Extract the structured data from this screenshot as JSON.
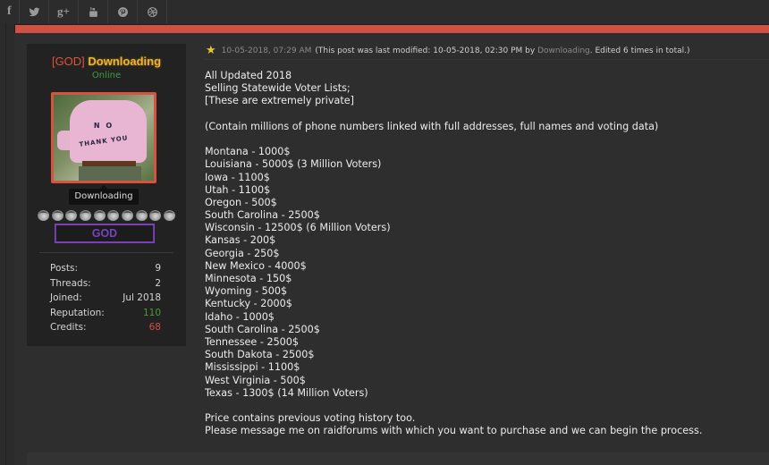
{
  "social": [
    {
      "name": "facebook-icon",
      "glyph": "f"
    },
    {
      "name": "twitter-icon",
      "glyph": ""
    },
    {
      "name": "google-plus-icon",
      "glyph": "g+"
    },
    {
      "name": "youtube-icon",
      "glyph": ""
    },
    {
      "name": "pinterest-icon",
      "glyph": ""
    },
    {
      "name": "dribbble-icon",
      "glyph": ""
    }
  ],
  "colors": {
    "accent": "#cf5142",
    "online": "#3e9d3e",
    "username": "#f0b232",
    "rank": "#7b3fb8",
    "reputation": "#4c9a35",
    "credits": "#dc4b43"
  },
  "user": {
    "tag": "[GOD]",
    "name": "Downloading",
    "status": "Online",
    "avatar_text_1": "N O",
    "avatar_text_2": "THANK YOU",
    "tooltip": "Downloading",
    "rank_stars": 10,
    "rank_label": "GOD",
    "stats": [
      {
        "label": "Posts:",
        "value": "9"
      },
      {
        "label": "Threads:",
        "value": "2"
      },
      {
        "label": "Joined:",
        "value": "Jul 2018"
      },
      {
        "label": "Reputation:",
        "value": "110"
      },
      {
        "label": "Credits:",
        "value": "68"
      }
    ]
  },
  "post": {
    "date": "10-05-2018, 07:29 AM",
    "modified_prefix": "(This post was last modified: 10-05-2018, 02:30 PM by",
    "modified_by": "Downloading",
    "modified_suffix": ". Edited 6 times in total.)",
    "intro": [
      "All Updated 2018",
      "Selling Statewide Voter Lists;",
      "[These are extremely private]"
    ],
    "note": "(Contain millions of phone numbers linked with full addresses, full names and voting data)",
    "listings": [
      "Montana - 1000$",
      "Louisiana - 5000$ (3 Million Voters)",
      "Iowa - 1100$",
      "Utah - 1100$",
      "Oregon - 500$",
      "South Carolina - 2500$",
      "Wisconsin - 12500$ (6 Million Voters)",
      "Kansas - 200$",
      "Georgia - 250$",
      "New Mexico - 4000$",
      "Minnesota - 150$",
      "Wyoming - 500$",
      "Kentucky - 2000$",
      "Idaho - 1000$",
      "South Carolina - 2500$",
      "Tennessee - 2500$",
      "South Dakota - 2500$",
      "Mississippi - 1100$",
      "West Virginia - 500$",
      "Texas - 1300$ (14 Million Voters)"
    ],
    "closing": [
      "Price contains previous voting history too.",
      "Please message me on raidforums with which you want to purchase and we can begin the process."
    ]
  }
}
